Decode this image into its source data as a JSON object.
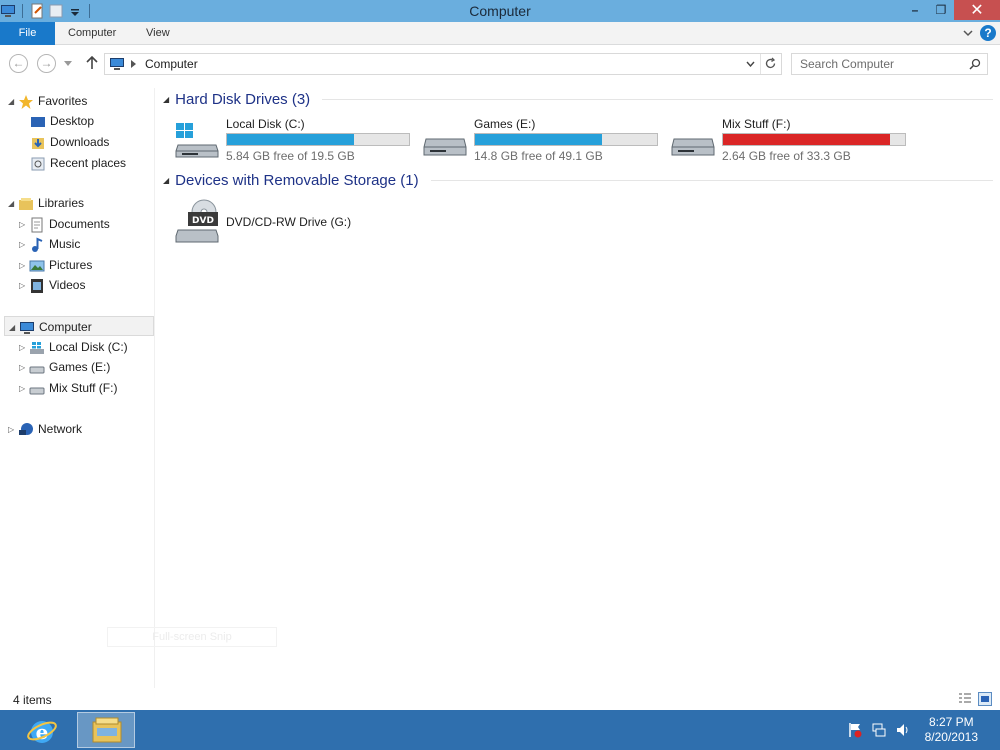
{
  "window": {
    "title": "Computer"
  },
  "ribbon": {
    "file": "File",
    "tabs": [
      "Computer",
      "View"
    ]
  },
  "address": {
    "location": "Computer"
  },
  "search": {
    "placeholder": "Search Computer"
  },
  "nav": {
    "favorites": "Favorites",
    "favorites_items": [
      "Desktop",
      "Downloads",
      "Recent places"
    ],
    "libraries": "Libraries",
    "libraries_items": [
      "Documents",
      "Music",
      "Pictures",
      "Videos"
    ],
    "computer": "Computer",
    "computer_items": [
      "Local Disk (C:)",
      "Games (E:)",
      "Mix Stuff (F:)"
    ],
    "network": "Network"
  },
  "groups": {
    "hard_disks": "Hard Disk Drives (3)",
    "removable": "Devices with Removable Storage (1)"
  },
  "drives": [
    {
      "name": "Local Disk (C:)",
      "free": "5.84 GB free of 19.5 GB",
      "used_fraction": 0.7,
      "color": "#26a0da"
    },
    {
      "name": "Games (E:)",
      "free": "14.8 GB free of 49.1 GB",
      "used_fraction": 0.7,
      "color": "#26a0da"
    },
    {
      "name": "Mix Stuff (F:)",
      "free": "2.64 GB free of 33.3 GB",
      "used_fraction": 0.92,
      "color": "#da2626"
    }
  ],
  "removable": [
    {
      "name": "DVD/CD-RW Drive (G:)",
      "icon_label": "DVD"
    }
  ],
  "snip_hint": "Full-screen Snip",
  "status": {
    "count": "4 items"
  },
  "taskbar": {
    "time": "8:27 PM",
    "date": "8/20/2013"
  }
}
